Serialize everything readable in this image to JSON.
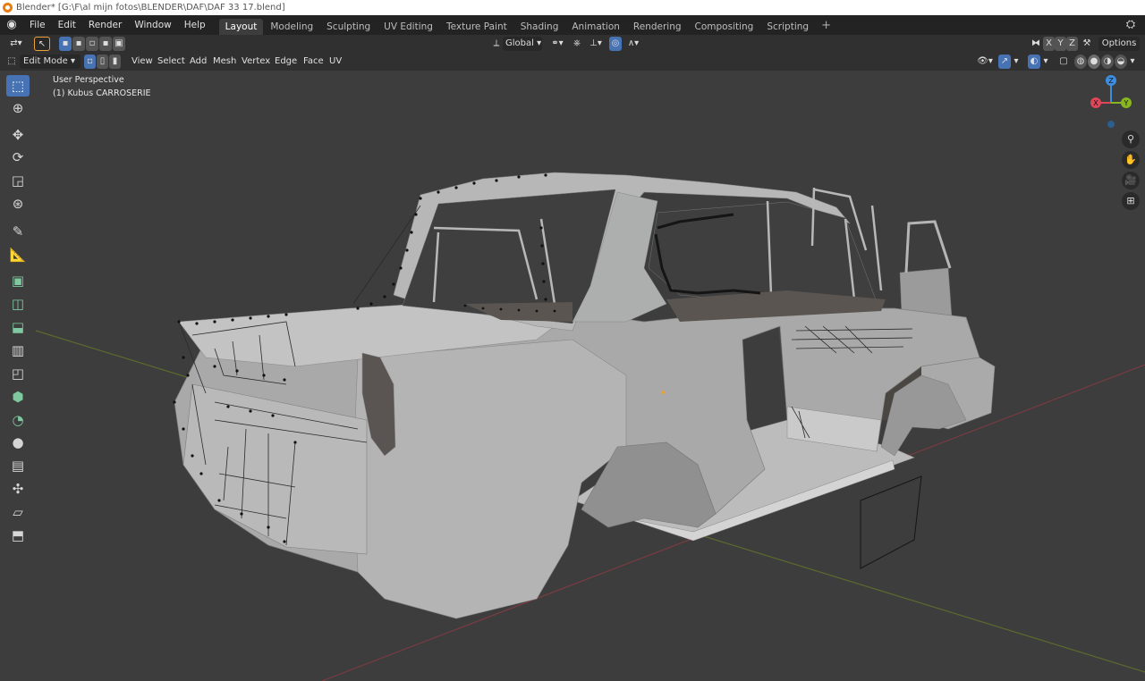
{
  "window": {
    "title": "Blender* [G:\\F\\al mijn fotos\\BLENDER\\DAF\\DAF 33 17.blend]"
  },
  "topbar": {
    "menus": [
      "File",
      "Edit",
      "Render",
      "Window",
      "Help"
    ],
    "workspaces": [
      "Layout",
      "Modeling",
      "Sculpting",
      "UV Editing",
      "Texture Paint",
      "Shading",
      "Animation",
      "Rendering",
      "Compositing",
      "Scripting"
    ],
    "active_workspace": "Layout",
    "add_label": "+"
  },
  "header1": {
    "orientation_label": "Global",
    "axis_x": "X",
    "axis_y": "Y",
    "axis_z": "Z",
    "options_label": "Options"
  },
  "header2": {
    "mode_label": "Edit Mode",
    "menus": [
      "View",
      "Select",
      "Add",
      "Mesh",
      "Vertex",
      "Edge",
      "Face",
      "UV"
    ]
  },
  "viewport": {
    "view_name": "User Perspective",
    "object_label": "(1) Kubus CARROSERIE"
  },
  "gizmo": {
    "x": "X",
    "y": "Y",
    "z": "Z"
  },
  "colors": {
    "accent": "#4772b3",
    "axis_x": "#e0465a",
    "axis_y": "#88b620",
    "axis_z": "#3d8ee0",
    "blender_orange": "#e87d0d"
  },
  "icons": {
    "tools": [
      "select-box-icon",
      "cursor-icon",
      "move-icon",
      "rotate-icon",
      "scale-icon",
      "transform-icon",
      "annotate-icon",
      "measure-icon",
      "extrude-icon",
      "inset-icon",
      "bevel-icon",
      "loop-cut-icon",
      "knife-icon",
      "poly-build-icon",
      "spin-icon",
      "smooth-icon",
      "edge-slide-icon",
      "shrink-fatten-icon",
      "shear-icon",
      "rip-icon"
    ]
  }
}
